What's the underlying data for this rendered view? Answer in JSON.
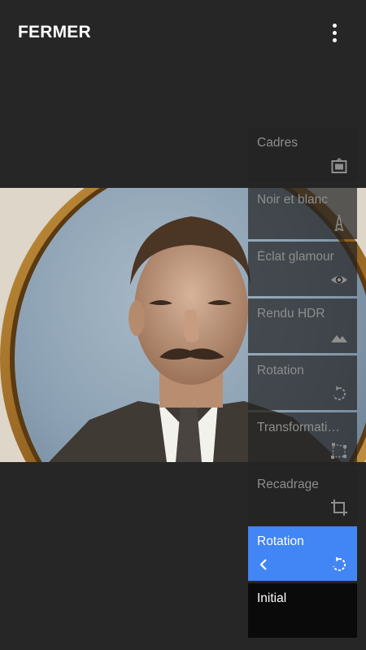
{
  "topbar": {
    "close_label": "FERMER",
    "more_icon": "more-vert-icon"
  },
  "tools": [
    {
      "label": "Cadres",
      "icon": "frame-icon",
      "state": "normal"
    },
    {
      "label": "Noir et blanc",
      "icon": "eiffel-tower-icon",
      "state": "normal"
    },
    {
      "label": "Éclat glamour",
      "icon": "eye-icon",
      "state": "normal"
    },
    {
      "label": "Rendu HDR",
      "icon": "mountains-icon",
      "state": "normal"
    },
    {
      "label": "Rotation",
      "icon": "rotate-icon",
      "state": "normal"
    },
    {
      "label": "Transformati…",
      "icon": "perspective-icon",
      "state": "normal"
    },
    {
      "label": "Recadrage",
      "icon": "crop-icon",
      "state": "normal"
    },
    {
      "label": "Rotation",
      "icon": "rotate-icon",
      "state": "active"
    },
    {
      "label": "Initial",
      "icon": "",
      "state": "initial"
    }
  ],
  "colors": {
    "background": "#262626",
    "accent": "#4285f4",
    "tool_bg": "#242424",
    "tool_text": "#8e8e8e"
  }
}
